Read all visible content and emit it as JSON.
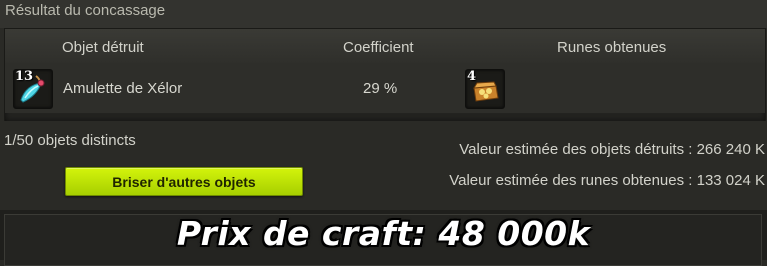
{
  "panel": {
    "title": "Résultat du concassage"
  },
  "table": {
    "headers": {
      "object": "Objet détruit",
      "coefficient": "Coefficient",
      "runes": "Runes obtenues"
    },
    "rows": [
      {
        "item_qty": "13",
        "item_icon": "amulet-icon",
        "item_name": "Amulette de Xélor",
        "coefficient": "29 %",
        "rune_qty": "4",
        "rune_icon": "rune-bag-icon"
      }
    ]
  },
  "footer": {
    "distinct": "1/50 objets distincts",
    "button_label": "Briser d'autres objets",
    "value_destroyed": "Valeur estimée des objets détruits : 266 240 K",
    "value_runes": "Valeur estimée des runes obtenues : 133 024 K"
  },
  "overlay_caption": "Prix de craft: 48 000k",
  "colors": {
    "button": "#c7ec00",
    "background": "#2a2a26"
  }
}
